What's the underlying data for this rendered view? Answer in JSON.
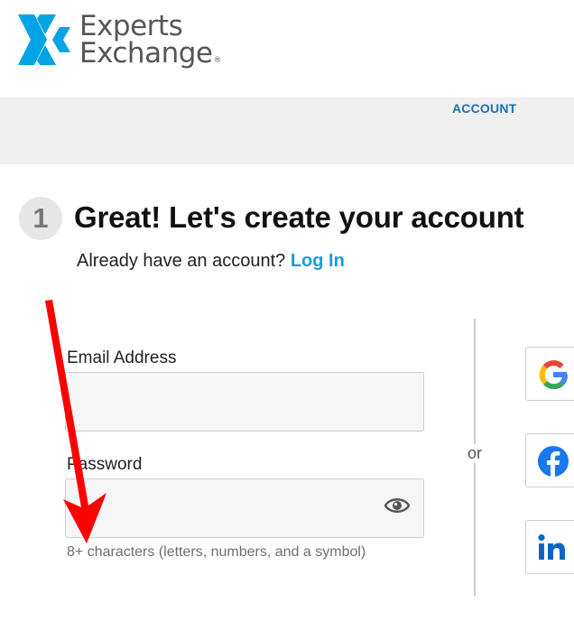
{
  "brand": {
    "name_line1": "Experts",
    "name_line2": "Exchange",
    "registered": "®"
  },
  "nav": {
    "account_label": "ACCOUNT"
  },
  "step": {
    "number": "1",
    "title": "Great! Let's create your account"
  },
  "login_prompt": {
    "text": "Already have an account?",
    "link_label": "Log In"
  },
  "form": {
    "email_label": "Email Address",
    "email_value": "",
    "password_label": "Password",
    "password_value": "",
    "password_hint": "8+ characters (letters, numbers, and a symbol)"
  },
  "divider_label": "or",
  "social_buttons": [
    {
      "provider": "Google",
      "icon": "google-icon"
    },
    {
      "provider": "Facebook",
      "icon": "facebook-icon",
      "color": "#1877f2"
    },
    {
      "provider": "LinkedIn",
      "icon": "linkedin-icon",
      "color": "#0a66c2"
    }
  ],
  "colors": {
    "brand_blue": "#00a4e4",
    "link_blue": "#1e9bd6",
    "nav_blue": "#1a73b5",
    "annotation_red": "#ff0000"
  }
}
